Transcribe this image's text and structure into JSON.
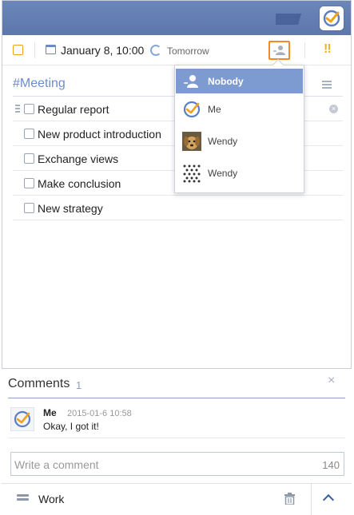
{
  "task": {
    "date": "January 8, 10:00",
    "repeat": "Tomorrow",
    "priority": "!!"
  },
  "list": {
    "title": "#Meeting",
    "name": "Work"
  },
  "subtasks": [
    {
      "label": "Regular report"
    },
    {
      "label": "New product introduction"
    },
    {
      "label": "Exchange views"
    },
    {
      "label": "Make conclusion"
    },
    {
      "label": "New strategy"
    }
  ],
  "assignee_menu": {
    "items": [
      {
        "label": "Nobody",
        "selected": true,
        "icon": "person-icon"
      },
      {
        "label": "Me",
        "selected": false,
        "icon": "app-logo"
      },
      {
        "label": "Wendy",
        "selected": false,
        "icon": "dog-photo"
      },
      {
        "label": "Wendy",
        "selected": false,
        "icon": "pattern-avatar"
      }
    ]
  },
  "comments": {
    "title": "Comments",
    "count": "1",
    "close": "×",
    "items": [
      {
        "author": "Me",
        "time": "2015-01-6 10:58",
        "text": "Okay, I got it!"
      }
    ],
    "input_placeholder": "Write a comment",
    "char_limit": "140"
  },
  "colors": {
    "header": "#5c77ab",
    "accent": "#7d9bd0",
    "checkbox_orange": "#f0a21d",
    "priority": "#f0b41d"
  }
}
